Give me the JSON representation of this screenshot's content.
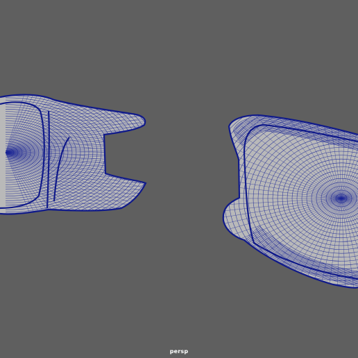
{
  "viewport": {
    "camera_name": "persp",
    "background_color": "#5f5f5f",
    "wireframe_color": "#1a2596",
    "objects": [
      "left-lens-frame-mesh",
      "right-lens-frame-mesh"
    ]
  }
}
